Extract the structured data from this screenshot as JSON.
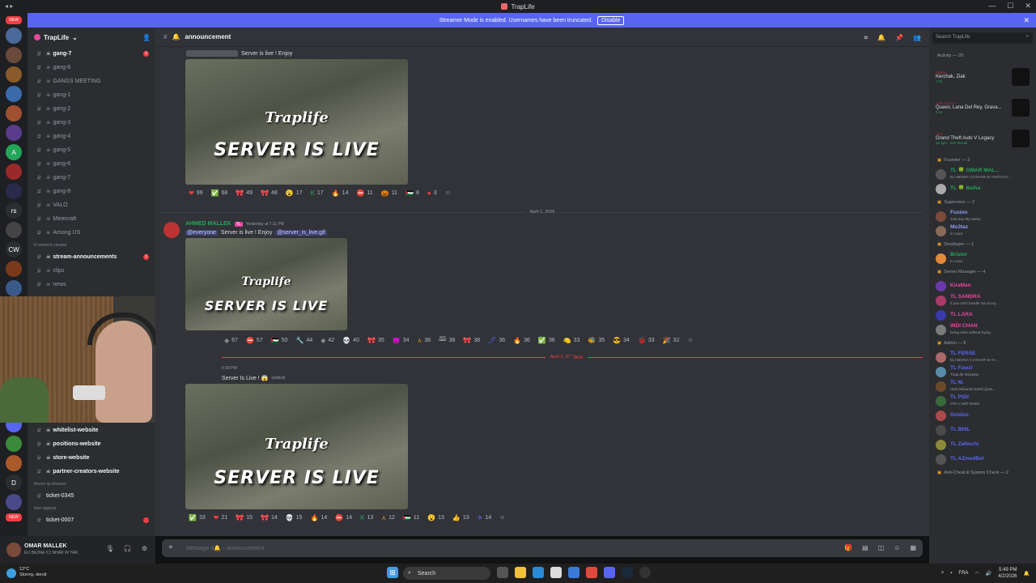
{
  "window": {
    "title": "TrapLife"
  },
  "banner": {
    "text": "Streamer Mode is enabled. Usernames have been truncated.",
    "button": "Disable"
  },
  "server": {
    "name": "TrapLife"
  },
  "guild_icons": [
    "NEW",
    "",
    "",
    "",
    "",
    "",
    "",
    "A",
    "",
    "",
    "rs",
    "",
    "CW",
    "",
    "",
    "",
    "",
    "",
    "",
    "",
    "",
    "",
    "",
    "",
    "D",
    "",
    "NEW"
  ],
  "channels_top": [
    {
      "name": "gang-7",
      "unread": true,
      "badge": "1"
    },
    {
      "name": "gang-8",
      "unread": false
    },
    {
      "name": "GANGS MEETING",
      "unread": false
    },
    {
      "name": "gang-1",
      "unread": false
    },
    {
      "name": "gang-2",
      "unread": false
    },
    {
      "name": "gang-3",
      "unread": false
    },
    {
      "name": "gang-4",
      "unread": false
    },
    {
      "name": "gang-5",
      "unread": false
    },
    {
      "name": "gang-6",
      "unread": false
    },
    {
      "name": "gang-7",
      "unread": false
    },
    {
      "name": "gang-8",
      "unread": false
    },
    {
      "name": "VALO",
      "unread": false
    },
    {
      "name": "Minecraft",
      "unread": false
    },
    {
      "name": "Among US",
      "unread": false
    }
  ],
  "category_creator": "tl content creator",
  "channels_creator": [
    {
      "name": "stream-announcements",
      "unread": true,
      "badge": "1"
    },
    {
      "name": "clips",
      "unread": false
    },
    {
      "name": "news",
      "unread": false
    }
  ],
  "channels_bottom": [
    {
      "name": "whitelist-website",
      "unread": true
    },
    {
      "name": "positions-website",
      "unread": true
    },
    {
      "name": "store-website",
      "unread": true
    },
    {
      "name": "partner-creators-website",
      "unread": true
    }
  ],
  "category_rp": "tlmort-rp-dossier",
  "ticket1": "ticket-0345",
  "category_ban": "ban-appeal",
  "ticket2": "ticket-0007",
  "user": {
    "name": "OMAR MALLEK",
    "status": "ELI BE3NA Y,3 NHAR W YAR"
  },
  "channel": {
    "name": "announcement"
  },
  "messages": [
    {
      "text": "Server is live ! Enjoy"
    },
    {
      "date_divider": "April 1, 2026",
      "author": "AHMED MALLEK",
      "timestamp": "Yesterday at 7:11 PM",
      "mention": "@everyone",
      "text": "Server is live ! Enjoy",
      "link": "@server_is_live.gif"
    },
    {
      "date_divider": "April 2, 2026",
      "new_label": "NEW",
      "timestamp": "6:18 PM",
      "text": "Server Is Live ! 😱",
      "edited": "(edited)"
    }
  ],
  "image": {
    "logo": "Traplife",
    "caption": "SERVER IS LIVE"
  },
  "reactions1": [
    {
      "e": "❤",
      "n": "99",
      "c": "#f23f43"
    },
    {
      "e": "✅",
      "n": "68",
      "c": "#23a55a"
    },
    {
      "e": "🎀",
      "n": "49",
      "c": "#e88"
    },
    {
      "e": "🎀",
      "n": "48",
      "c": "#e9a"
    },
    {
      "e": "😮",
      "n": "17",
      "c": "#f0b232"
    },
    {
      "e": "K",
      "n": "17",
      "c": "#23a55a"
    },
    {
      "e": "🔥",
      "n": "14",
      "c": "#f0b232"
    },
    {
      "e": "⛔",
      "n": "11",
      "c": "#f23f43"
    },
    {
      "e": "🎃",
      "n": "11",
      "c": "#f0a020"
    },
    {
      "e": "🇵🇸",
      "n": "8",
      "c": "#23a55a"
    },
    {
      "e": "●",
      "n": "3",
      "c": "#f23f43"
    }
  ],
  "reactions2": [
    {
      "e": "",
      "n": "67",
      "c": "#888"
    },
    {
      "e": "⛔",
      "n": "57",
      "c": "#f23f43"
    },
    {
      "e": "🇵🇸",
      "n": "50",
      "c": "#23a55a"
    },
    {
      "e": "🔧",
      "n": "44",
      "c": "#aaa"
    },
    {
      "e": "",
      "n": "42",
      "c": "#888"
    },
    {
      "e": "💀",
      "n": "40",
      "c": "#ddd"
    },
    {
      "e": "🎀",
      "n": "35",
      "c": "#e88"
    },
    {
      "e": "😈",
      "n": "34",
      "c": "#f0a020"
    },
    {
      "e": "⋏",
      "n": "36",
      "c": "#f0a020"
    },
    {
      "e": "🕮",
      "n": "38",
      "c": "#aaa"
    },
    {
      "e": "🎀",
      "n": "38",
      "c": "#e9a"
    },
    {
      "e": "🖊",
      "n": "36",
      "c": "#5865f2"
    },
    {
      "e": "🔥",
      "n": "36",
      "c": "#f0a020"
    },
    {
      "e": "✅",
      "n": "36",
      "c": "#23a55a"
    },
    {
      "e": "🍋",
      "n": "33",
      "c": "#f0b232"
    },
    {
      "e": "🐝",
      "n": "35",
      "c": "#aaa"
    },
    {
      "e": "😎",
      "n": "34",
      "c": "#f0b232"
    },
    {
      "e": "🐞",
      "n": "33",
      "c": "#f23f43"
    },
    {
      "e": "🎉",
      "n": "32",
      "c": "#f23f43"
    }
  ],
  "reactions3": [
    {
      "e": "✅",
      "n": "33",
      "c": "#23a55a"
    },
    {
      "e": "❤",
      "n": "21",
      "c": "#f23f43"
    },
    {
      "e": "🎀",
      "n": "15",
      "c": "#e88"
    },
    {
      "e": "🎀",
      "n": "14",
      "c": "#e9a"
    },
    {
      "e": "💀",
      "n": "15",
      "c": "#ddd"
    },
    {
      "e": "🔥",
      "n": "14",
      "c": "#f0a020"
    },
    {
      "e": "⛔",
      "n": "14",
      "c": "#f23f43"
    },
    {
      "e": "K",
      "n": "13",
      "c": "#23a55a"
    },
    {
      "e": "⋏",
      "n": "12",
      "c": "#f0a020"
    },
    {
      "e": "🇵🇸",
      "n": "11",
      "c": "#23a55a"
    },
    {
      "e": "😮",
      "n": "13",
      "c": "#f0b232"
    },
    {
      "e": "👍",
      "n": "13",
      "c": "#f0b232"
    },
    {
      "e": "✈",
      "n": "14",
      "c": "#5865f2"
    }
  ],
  "composer": {
    "placeholder": "Message #🔔・announcement"
  },
  "search": {
    "placeholder": "Search TrapLife"
  },
  "activity": {
    "header": "Activity — 20",
    "items": [
      {
        "tag": "Fusion",
        "title": "Kerchak, Ziak",
        "sub": "1:51"
      },
      {
        "tag": "Jack Tyrone",
        "title": "Quavo, Lana Del Rey, Grava...",
        "sub": "0:41"
      },
      {
        "tag": "Azzi",
        "title": "Grand Theft Auto V Legacy",
        "sub": "1d ago · 23x Streak"
      }
    ]
  },
  "member_groups": [
    {
      "title": "Founder — 2",
      "members": [
        {
          "name": "TL 🍀 OMAR MAL...",
          "sub": "ELI BE3NA Y,3 NHAR W YARTHA3...",
          "color": "#23a55a"
        },
        {
          "name": "TL 🍀 Belha",
          "sub": "",
          "color": "#23a55a"
        }
      ]
    },
    {
      "title": "Supervisor — 2",
      "members": [
        {
          "name": "Fusion",
          "sub": "Just Say My Name",
          "color": "#949cf7"
        },
        {
          "name": "Mo3taz",
          "sub": "In voice",
          "color": "#949cf7"
        }
      ]
    },
    {
      "title": "Developer — 1",
      "members": [
        {
          "name": "Bristol",
          "sub": "In voice",
          "color": "#23a55a"
        }
      ]
    },
    {
      "title": "Server Manager — 4",
      "members": [
        {
          "name": "KiraMan",
          "sub": "",
          "color": "#eb459e"
        },
        {
          "name": "TL SANDRA",
          "sub": "If you can't handle me at my...",
          "color": "#eb459e"
        },
        {
          "name": "TL LARA",
          "sub": "",
          "color": "#eb459e"
        },
        {
          "name": "INDI CHAN",
          "sub": "being seen without trying",
          "color": "#eb459e"
        }
      ]
    },
    {
      "title": "Admin — 8",
      "members": [
        {
          "name": "TL FERSE",
          "sub": "ELI BE3NA Y,3 NHAR W YA...",
          "color": "#5865f2"
        },
        {
          "name": "TL Fawzi",
          "sub": "TrapLife Roleplay",
          "color": "#5865f2"
        },
        {
          "name": "TL M.",
          "sub": "Utek lekbaeda kamb grow...",
          "color": "#5865f2"
        },
        {
          "name": "TL PSN",
          "sub": "GTA V with Medal",
          "color": "#5865f2"
        },
        {
          "name": "Gnidoo",
          "sub": "",
          "color": "#5865f2"
        },
        {
          "name": "TL BHIL",
          "sub": "",
          "color": "#5865f2"
        },
        {
          "name": "TL ZaNochi",
          "sub": "",
          "color": "#5865f2"
        },
        {
          "name": "TL AZmedBel",
          "sub": "",
          "color": "#5865f2"
        }
      ]
    },
    {
      "title": "Anti-Cheat & System Check — 2",
      "members": []
    }
  ],
  "taskbar": {
    "search": "Search",
    "weather_temp": "12°C",
    "weather_sub": "Stormy, dersit",
    "lang": "FRA",
    "time": "5:49 PM",
    "date": "4/2/2026"
  }
}
